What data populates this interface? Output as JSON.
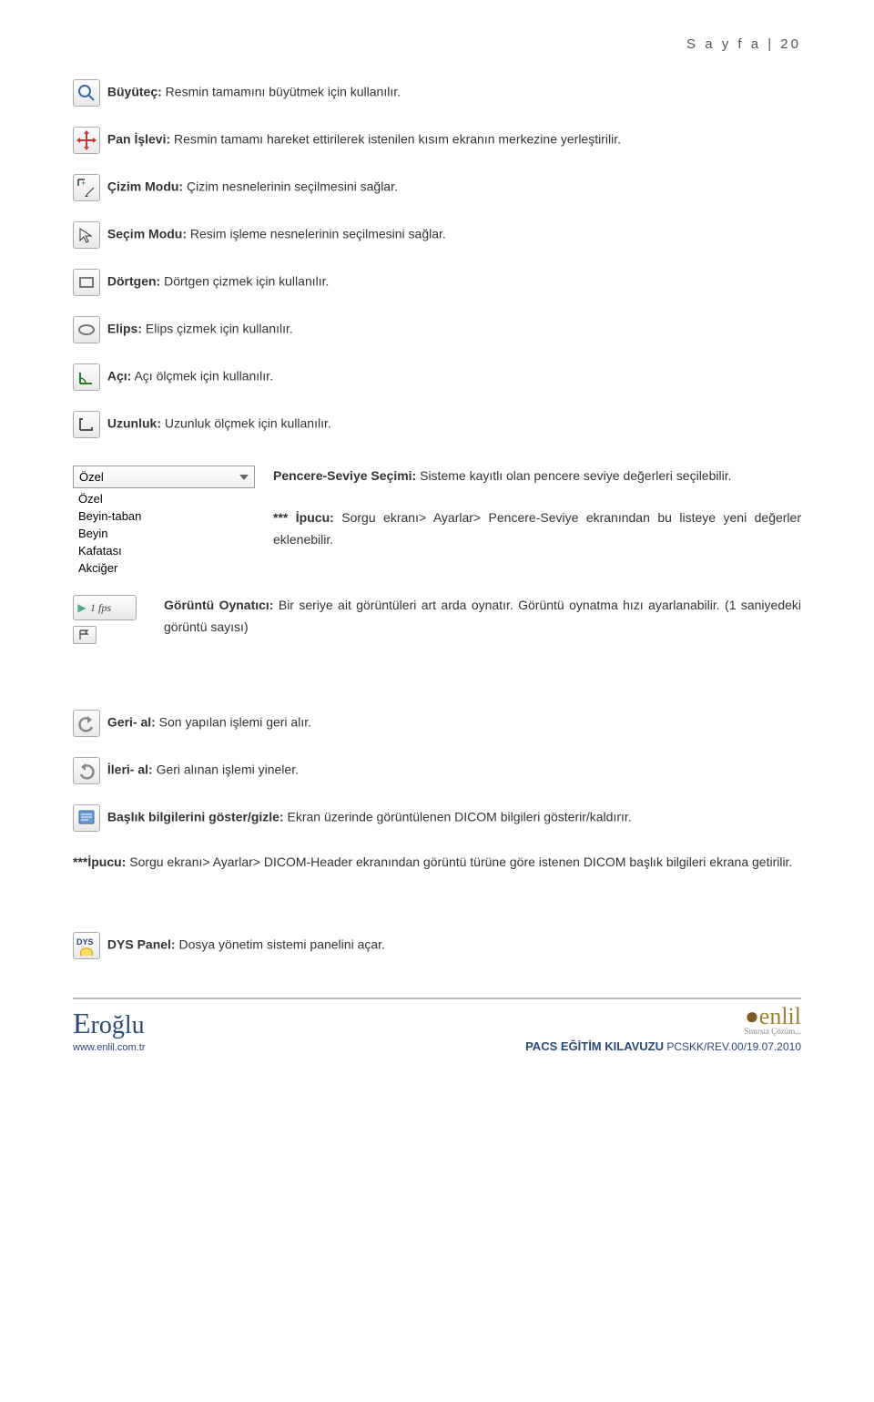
{
  "header": {
    "page_label": "S a y f a  | 20"
  },
  "items": {
    "magnify": {
      "label": "Büyüteç:",
      "desc": " Resmin tamamını büyütmek için kullanılır."
    },
    "pan": {
      "label": "Pan İşlevi:",
      "desc": " Resmin tamamı hareket ettirilerek istenilen kısım ekranın merkezine yerleştirilir."
    },
    "drawmode": {
      "label": "Çizim Modu:",
      "desc": " Çizim nesnelerinin seçilmesini sağlar."
    },
    "selmode": {
      "label": "Seçim Modu:",
      "desc": " Resim işleme nesnelerinin seçilmesini sağlar."
    },
    "rect": {
      "label": "Dörtgen:",
      "desc": " Dörtgen çizmek için kullanılır."
    },
    "ellipse": {
      "label": "Elips:",
      "desc": " Elips çizmek için kullanılır."
    },
    "angle": {
      "label": "Açı:",
      "desc": " Açı ölçmek için kullanılır."
    },
    "length": {
      "label": "Uzunluk:",
      "desc": " Uzunluk ölçmek için kullanılır."
    },
    "wl": {
      "label": "Pencere-Seviye Seçimi:",
      "desc": " Sisteme kayıtlı olan pencere seviye değerleri seçilebilir.",
      "tip_label": "*** İpucu:",
      "tip_desc": " Sorgu ekranı> Ayarlar> Pencere-Seviye ekranından bu listeye yeni değerler eklenebilir."
    },
    "cine": {
      "label": "Görüntü Oynatıcı:",
      "desc": " Bir seriye ait görüntüleri art arda oynatır. Görüntü oynatma hızı ayarlanabilir. (1 saniyedeki görüntü sayısı)",
      "fps": "1 fps"
    },
    "undo": {
      "label": "Geri- al:",
      "desc": " Son yapılan işlemi geri alır."
    },
    "redo": {
      "label": "İleri- al:",
      "desc": " Geri alınan işlemi yineler."
    },
    "header_toggle": {
      "label": "Başlık bilgilerini göster/gizle:",
      "desc": " Ekran üzerinde görüntülenen DICOM bilgileri gösterir/kaldırır.",
      "tip_label": "***İpucu:",
      "tip_desc": " Sorgu ekranı> Ayarlar> DICOM-Header ekranından görüntü türüne göre istenen DICOM başlık bilgileri ekrana getirilir."
    },
    "dys": {
      "label": "DYS Panel:",
      "desc": " Dosya yönetim sistemi panelini açar.",
      "badge": "DYS"
    }
  },
  "dropdown": {
    "selected": "Özel",
    "options": [
      "Özel",
      "Beyin-taban",
      "Beyin",
      "Kafatası",
      "Akciğer"
    ]
  },
  "footer": {
    "eroglu": "Eroğlu",
    "url": "www.enlil.com.tr",
    "enlil": "enlil",
    "enlil_sub": "Sınırsız Çözüm...",
    "doc_title": "PACS EĞİTİM KILAVUZU",
    "doc_rev": " PCSKK/REV.00/19.07.2010"
  }
}
